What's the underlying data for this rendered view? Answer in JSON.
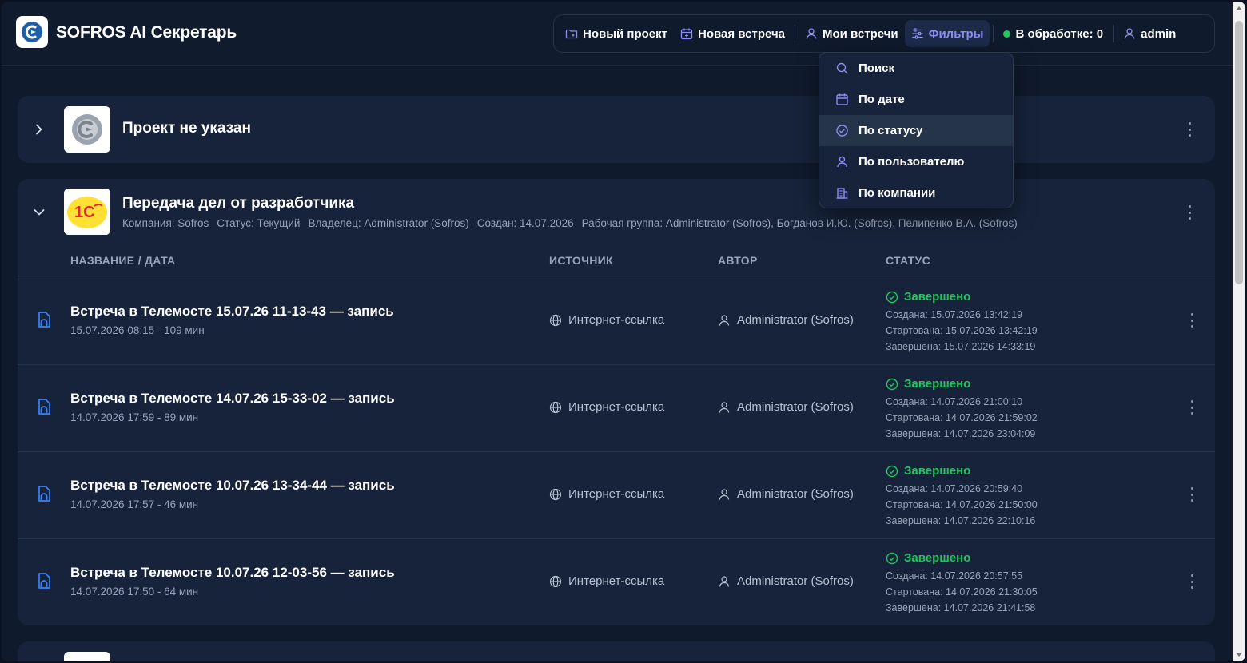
{
  "app": {
    "title": "SOFROS AI Секретарь"
  },
  "nav": {
    "new_project": "Новый проект",
    "new_meeting": "Новая встреча",
    "my_meetings": "Мои встречи",
    "filters": "Фильтры",
    "processing": "В обработке: 0",
    "user": "admin"
  },
  "filters_menu": {
    "items": [
      "Поиск",
      "По дате",
      "По статусу",
      "По пользователю",
      "По компании"
    ],
    "highlighted": "По статусу"
  },
  "projects": [
    {
      "title": "Проект не указан",
      "expanded": false
    },
    {
      "title": "Передача дел от разработчика",
      "expanded": true,
      "meta": {
        "company": "Компания: Sofros",
        "status": "Статус: Текущий",
        "owner": "Владелец: Administrator (Sofros)",
        "created": "Создан: 14.07.2026",
        "group": "Рабочая группа: Administrator (Sofros), Богданов И.Ю. (Sofros), Пелипенко В.А. (Sofros)"
      },
      "columns": [
        "НАЗВАНИЕ / ДАТА",
        "ИСТОЧНИК",
        "АВТОР",
        "СТАТУС"
      ],
      "meetings": [
        {
          "title": "Встреча в Телемосте 15.07.26 11-13-43 — запись",
          "sub": "15.07.2026 08:15 - 109 мин",
          "source": "Интернет-ссылка",
          "author": "Administrator (Sofros)",
          "status": "Завершено",
          "created": "Создана: 15.07.2026 13:42:19",
          "started": "Стартована: 15.07.2026 13:42:19",
          "finished": "Завершена: 15.07.2026 14:33:19"
        },
        {
          "title": "Встреча в Телемосте 14.07.26 15-33-02 — запись",
          "sub": "14.07.2026 17:59 - 89 мин",
          "source": "Интернет-ссылка",
          "author": "Administrator (Sofros)",
          "status": "Завершено",
          "created": "Создана: 14.07.2026 21:00:10",
          "started": "Стартована: 14.07.2026 21:59:02",
          "finished": "Завершена: 14.07.2026 23:04:09"
        },
        {
          "title": "Встреча в Телемосте 10.07.26 13-34-44 — запись",
          "sub": "14.07.2026 17:57 - 46 мин",
          "source": "Интернет-ссылка",
          "author": "Administrator (Sofros)",
          "status": "Завершено",
          "created": "Создана: 14.07.2026 20:59:40",
          "started": "Стартована: 14.07.2026 21:50:00",
          "finished": "Завершена: 14.07.2026 22:10:16"
        },
        {
          "title": "Встреча в Телемосте 10.07.26 12-03-56 — запись",
          "sub": "14.07.2026 17:50 - 64 мин",
          "source": "Интернет-ссылка",
          "author": "Administrator (Sofros)",
          "status": "Завершено",
          "created": "Создана: 14.07.2026 20:57:55",
          "started": "Стартована: 14.07.2026 21:30:05",
          "finished": "Завершена: 14.07.2026 21:41:58"
        }
      ]
    }
  ],
  "icons": {
    "logo": "sofros-logo-icon",
    "new_project": "folder-plus-icon",
    "new_meeting": "calendar-plus-icon",
    "my_meetings": "user-icon",
    "filters": "sliders-icon",
    "processing": "green-dot-icon",
    "search": "search-icon",
    "date": "calendar-icon",
    "status": "check-circle-icon",
    "user": "user-icon",
    "company": "building-icon",
    "meeting": "audio-file-icon",
    "source": "globe-icon",
    "author": "user-icon",
    "more": "kebab-menu-icon"
  },
  "colors": {
    "background": "#0f1a2c",
    "card": "#16233a",
    "accent": "#8b8cf8",
    "success": "#22c55e",
    "meeting_icon": "#3b82f6",
    "brand_blue": "#1e5fa8",
    "brand_1c_yellow": "#ffe135",
    "brand_1c_red": "#e3262b"
  }
}
